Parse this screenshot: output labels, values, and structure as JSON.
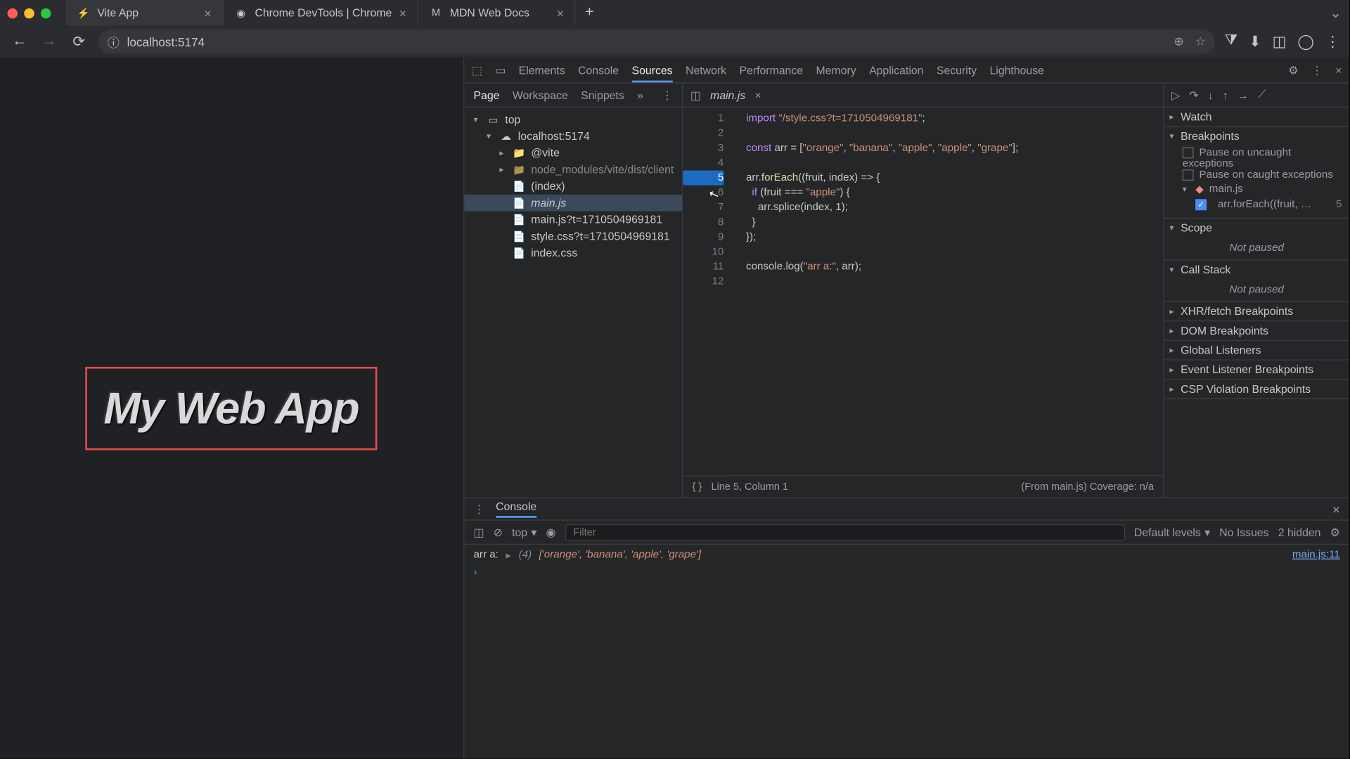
{
  "tabs": [
    {
      "title": "Vite App",
      "active": true
    },
    {
      "title": "Chrome DevTools | Chrome",
      "active": false
    },
    {
      "title": "MDN Web Docs",
      "active": false
    }
  ],
  "url": "localhost:5174",
  "page": {
    "title": "My Web App"
  },
  "devtools": {
    "panels": [
      "Elements",
      "Console",
      "Sources",
      "Network",
      "Performance",
      "Memory",
      "Application",
      "Security",
      "Lighthouse"
    ],
    "active_panel": "Sources",
    "subtabs": [
      "Page",
      "Workspace",
      "Snippets"
    ],
    "active_subtab": "Page",
    "tree": {
      "top": "top",
      "host": "localhost:5174",
      "vite": "@vite",
      "node_mod": "node_modules/vite/dist/client",
      "index": "(index)",
      "mainjs": "main.js",
      "mainjs_q": "main.js?t=1710504969181",
      "stylecss_q": "style.css?t=1710504969181",
      "indexcss": "index.css"
    },
    "open_file": "main.js",
    "code_lines": [
      "1",
      "2",
      "3",
      "4",
      "5",
      "6",
      "7",
      "8",
      "9",
      "10",
      "11",
      "12"
    ],
    "breakpoint_line": 5,
    "status_left": "Line 5, Column 1",
    "status_right": "(From main.js) Coverage: n/a",
    "code": {
      "l1_import": "import",
      "l1_path": "\"/style.css?t=1710504969181\"",
      "l3_const": "const",
      "l3_arr": "arr = [",
      "l3_v1": "\"orange\"",
      "l3_v2": "\"banana\"",
      "l3_v3": "\"apple\"",
      "l3_v4": "\"apple\"",
      "l3_v5": "\"grape\"",
      "l5_call": "arr.",
      "l5_fn": "forEach",
      "l5_params": "((fruit, index) => {",
      "l6_if": "  if",
      "l6_cond": " (fruit === ",
      "l6_apple": "\"apple\"",
      "l6_end": ") {",
      "l7_splice": "    arr.splice(index, 1);",
      "l8": "  }",
      "l9": "});",
      "l11_log": "console.log(",
      "l11_str": "\"arr a:\"",
      "l11_end": ", arr);"
    },
    "right": {
      "watch": "Watch",
      "breakpoints": "Breakpoints",
      "pause_uncaught": "Pause on uncaught exceptions",
      "pause_caught": "Pause on caught exceptions",
      "bp_file": "main.js",
      "bp_preview": "arr.forEach((fruit, …",
      "bp_line": "5",
      "scope": "Scope",
      "not_paused": "Not paused",
      "callstack": "Call Stack",
      "xhr": "XHR/fetch Breakpoints",
      "dom": "DOM Breakpoints",
      "global": "Global Listeners",
      "event": "Event Listener Breakpoints",
      "csp": "CSP Violation Breakpoints"
    }
  },
  "console": {
    "title": "Console",
    "context": "top",
    "filter_placeholder": "Filter",
    "levels": "Default levels",
    "issues": "No Issues",
    "hidden": "2 hidden",
    "log_label": "arr a:",
    "log_count": "(4)",
    "log_array": "['orange', 'banana', 'apple', 'grape']",
    "log_link": "main.js:11"
  }
}
